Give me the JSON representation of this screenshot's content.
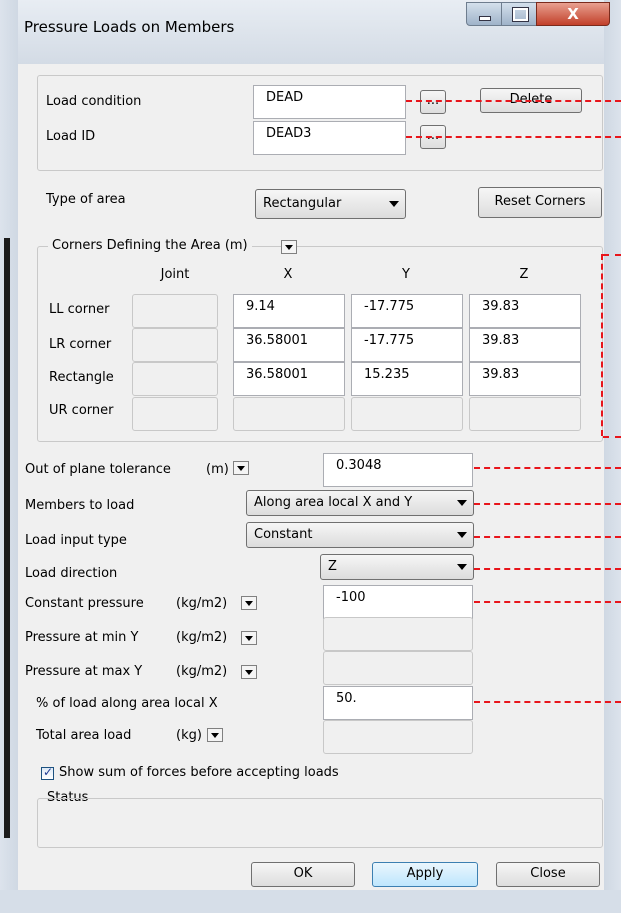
{
  "window": {
    "title": "Pressure Loads on Members",
    "close_glyph": "X"
  },
  "load": {
    "condition_label": "Load condition",
    "condition_value": "DEAD",
    "id_label": "Load ID",
    "id_value": "DEAD3",
    "browse_label": "...",
    "delete_label": "Delete"
  },
  "area": {
    "type_label": "Type of area",
    "type_value": "Rectangular",
    "reset_label": "Reset Corners"
  },
  "corners": {
    "group_label": "Corners Defining the Area (m)",
    "headers": {
      "joint": "Joint",
      "x": "X",
      "y": "Y",
      "z": "Z"
    },
    "rows": [
      {
        "label": "LL corner",
        "x": "9.14",
        "y": "-17.775",
        "z": "39.83"
      },
      {
        "label": "LR corner",
        "x": "36.58001",
        "y": "-17.775",
        "z": "39.83"
      },
      {
        "label": "Rectangle",
        "x": "36.58001",
        "y": "15.235",
        "z": "39.83"
      },
      {
        "label": "UR corner",
        "x": "",
        "y": "",
        "z": ""
      }
    ]
  },
  "params": {
    "tolerance_label": "Out of plane tolerance",
    "tolerance_unit": "(m)",
    "tolerance_value": "0.3048",
    "members_label": "Members to load",
    "members_value": "Along area local X and Y",
    "input_type_label": "Load input type",
    "input_type_value": "Constant",
    "direction_label": "Load direction",
    "direction_value": "Z",
    "const_pressure_label": "Constant pressure",
    "const_pressure_unit": "(kg/m2)",
    "const_pressure_value": "-100",
    "pmin_label": "Pressure at min Y",
    "pmin_unit": "(kg/m2)",
    "pmax_label": "Pressure at max Y",
    "pmax_unit": "(kg/m2)",
    "pct_label": "% of load along area local X",
    "pct_value": "50.",
    "total_label": "Total area load",
    "total_unit": "(kg)"
  },
  "options": {
    "show_sum_label": "Show sum of forces before accepting loads",
    "show_sum_checked": true
  },
  "status": {
    "label": "Status"
  },
  "footer": {
    "ok_label": "OK",
    "apply_label": "Apply",
    "close_label": "Close"
  },
  "colors": {
    "annotation": "#e8151b",
    "apply_border": "#3c7fb1"
  }
}
